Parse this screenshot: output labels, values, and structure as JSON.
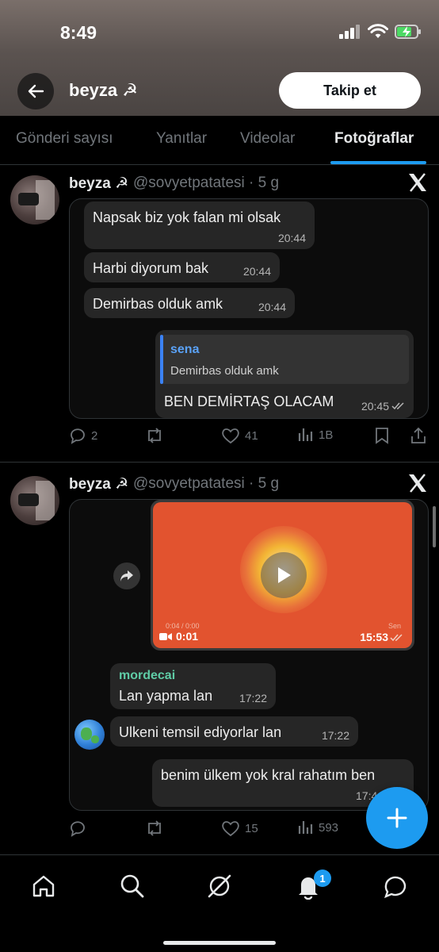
{
  "status_bar": {
    "time": "8:49"
  },
  "header": {
    "profile_name": "beyza ☭",
    "follow_label": "Takip et"
  },
  "tabs": [
    {
      "label": "Gönderi sayısı"
    },
    {
      "label": "Yanıtlar"
    },
    {
      "label": "Videolar"
    },
    {
      "label": "Fotoğraflar"
    }
  ],
  "posts": [
    {
      "name": "beyza ☭",
      "meta": "@sovyetpatatesi · 5 g",
      "messages": [
        {
          "text": "Napsak biz yok falan mi olsak",
          "time": "20:44"
        },
        {
          "text": "Harbi diyorum bak",
          "time": "20:44"
        },
        {
          "text": "Demirbas olduk amk",
          "time": "20:44"
        }
      ],
      "reply": {
        "quoted_name": "sena",
        "quoted_text": "Demirbas olduk amk",
        "text": "BEN DEMİRTAŞ OLACAM",
        "time": "20:45"
      },
      "actions": {
        "replies": "2",
        "likes": "41",
        "views": "1B"
      }
    },
    {
      "name": "beyza ☭",
      "meta": "@sovyetpatatesi · 5 g",
      "video": {
        "duration": "0:01",
        "time": "15:53",
        "overlay_small": "0:04 / 0:00",
        "overlay_right": "Sen"
      },
      "messages": [
        {
          "sender": "mordecai",
          "text": "Lan yapma lan",
          "time": "17:22"
        },
        {
          "text": "Ulkeni temsil ediyorlar lan",
          "time": "17:22"
        },
        {
          "text": "benim ülkem yok kral rahatım ben",
          "time": "17:4"
        }
      ],
      "actions": {
        "likes": "15",
        "views": "593"
      }
    }
  ],
  "bottom_nav": {
    "notifications_badge": "1"
  },
  "colors": {
    "accent": "#1d9bf0",
    "bubble": "#262626",
    "video_bg": "#e2532f",
    "reply_bar": "#3b82f6",
    "sender_green": "#5fcca6"
  }
}
